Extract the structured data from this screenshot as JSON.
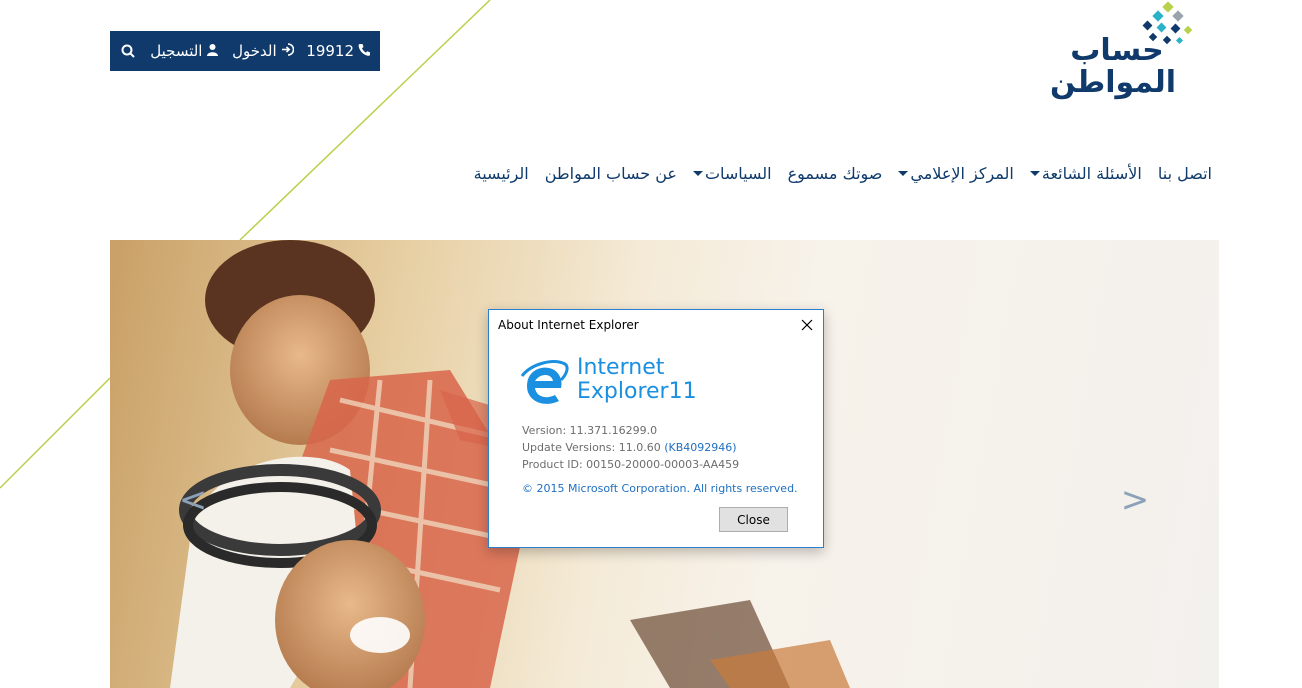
{
  "topbar": {
    "register_label": "التسجيل",
    "login_label": "الدخول",
    "phone": "19912",
    "icons": {
      "search": "search-icon",
      "user": "user-icon",
      "login": "login-icon",
      "phone": "phone-icon"
    }
  },
  "logo": {
    "line1": "حساب",
    "line2": "المواطن"
  },
  "nav": {
    "items": [
      {
        "label": "الرئيسية",
        "dropdown": false
      },
      {
        "label": "عن حساب المواطن",
        "dropdown": false
      },
      {
        "label": "السياسات",
        "dropdown": true
      },
      {
        "label": "صوتك مسموع",
        "dropdown": false
      },
      {
        "label": "المركز الإعلامي",
        "dropdown": true
      },
      {
        "label": "الأسئلة الشائعة",
        "dropdown": true
      },
      {
        "label": "اتصل بنا",
        "dropdown": false
      }
    ]
  },
  "hero": {
    "prev_label": "<",
    "next_label": ">"
  },
  "dialog": {
    "title": "About Internet Explorer",
    "product_name_line1": "Internet",
    "product_name_line2": "Explorer",
    "product_version_badge": "11",
    "version": "Version: 11.371.16299.0",
    "update_versions": "Update Versions: 11.0.60",
    "kb": "(KB4092946)",
    "product_id": "Product ID: 00150-20000-00003-AA459",
    "copyright": "© 2015 Microsoft Corporation. All rights reserved.",
    "close_button": "Close"
  },
  "colors": {
    "brand_navy": "#0f3a6b",
    "accent_lime": "#b7d24a",
    "ie_blue": "#1b8fe0"
  }
}
